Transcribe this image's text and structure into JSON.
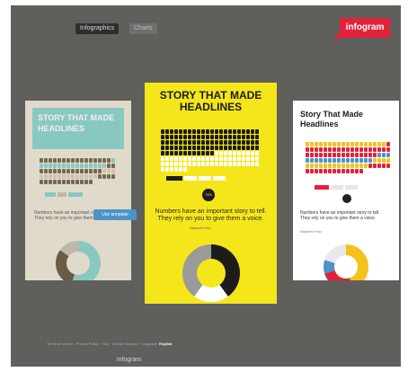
{
  "header": {
    "tabs": [
      {
        "label": "Infographics",
        "active": true
      },
      {
        "label": "Charts",
        "active": false
      }
    ],
    "logo": "infogram"
  },
  "colors": {
    "background": "#5f5f5c",
    "brand_red": "#e2223b",
    "featured_yellow": "#f5e61b",
    "teal": "#8ed4cc",
    "tooltip_blue": "#4c94c6"
  },
  "gallery": {
    "left_card": {
      "title": "STORY THAT MADE HEADLINES",
      "tooltip": "Use template",
      "text": "Numbers have an important story to tell. They rely on you to give them a voice."
    },
    "center_card": {
      "title": "STORY THAT MADE HEADLINES",
      "badge": "75%",
      "body": "Numbers have an important story to tell. They rely on you to give them a voice.",
      "source": "Stephen Few"
    },
    "right_card": {
      "title": "Story That Made Headlines",
      "body": "Numbers have an important story to tell. They rely on you to give them a voice.",
      "source": "Stephen Few"
    }
  },
  "footer": {
    "links": "Terms of service · Privacy Policy · FAQ · Contact Support · Language:",
    "language": "English",
    "logo": "infogram"
  }
}
